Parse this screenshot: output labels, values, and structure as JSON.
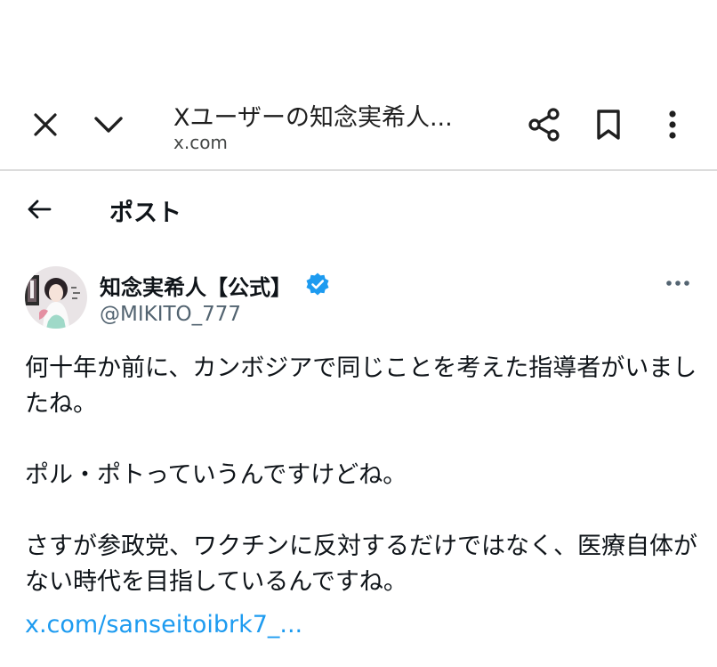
{
  "browser": {
    "title": "Xユーザーの知念実希人...",
    "domain": "x.com",
    "icons": {
      "close": "close-icon",
      "minimize": "chevron-down-icon",
      "share": "share-icon",
      "bookmark": "bookmark-icon",
      "menu": "more-vertical-icon"
    }
  },
  "app_header": {
    "back_icon": "arrow-left-icon",
    "title": "ポスト"
  },
  "post": {
    "author": {
      "name": "知念実希人【公式】",
      "handle": "@MIKITO_777",
      "verified": true,
      "verified_color": "#1d9bf0"
    },
    "more_icon": "more-horizontal-icon",
    "paragraphs": [
      "何十年か前に、カンボジアで同じことを考えた指導者がいましたね。",
      "ポル・ポトっていうんですけどね。",
      "さすが参政党、ワクチンに反対するだけではなく、医療自体がない時代を目指しているんですね。"
    ],
    "link": "x.com/sanseitoibrk7_..."
  },
  "colors": {
    "text": "#0f1419",
    "secondary": "#536471",
    "link": "#1d9bf0",
    "divider": "#dcdcdc"
  }
}
